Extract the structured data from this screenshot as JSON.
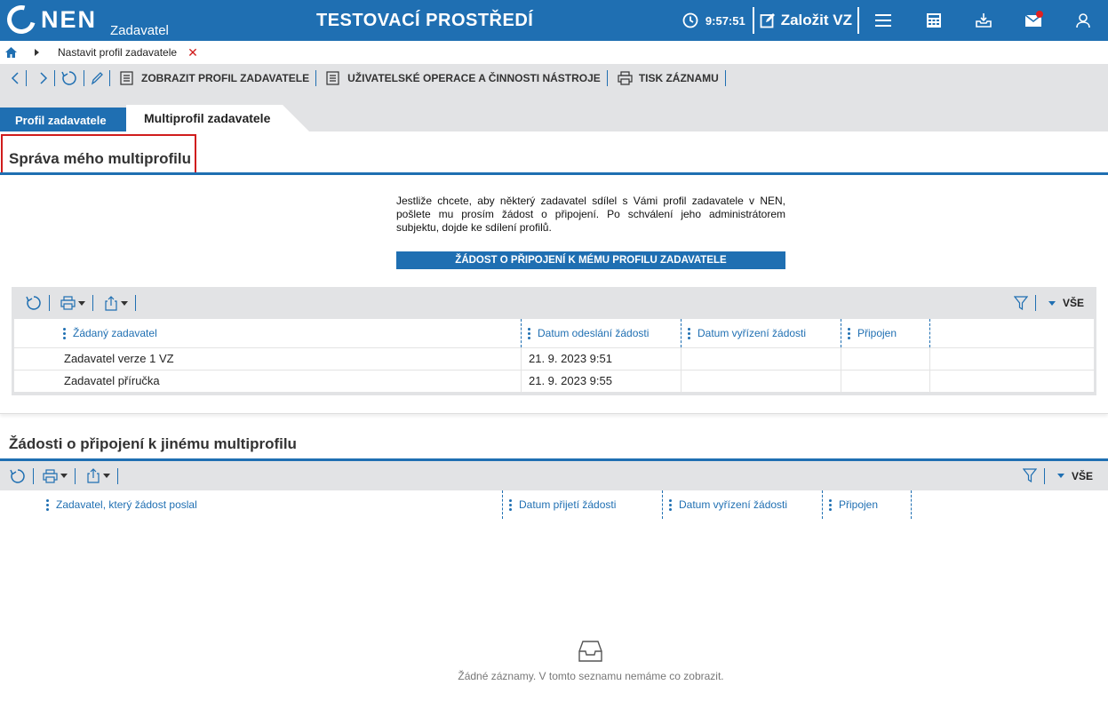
{
  "header": {
    "logo_text": "NEN",
    "logo_sub": "Zadavatel",
    "env_title": "TESTOVACÍ PROSTŘEDÍ",
    "clock": "9:57:51",
    "new_label": "Založit VZ",
    "icons": [
      "clock-icon",
      "edit-icon",
      "menu-icon",
      "calculator-icon",
      "inbox-download-icon",
      "mail-icon",
      "user-icon"
    ],
    "accent": "#1f6fb2",
    "notification_color": "#e02020"
  },
  "breadcrumb": {
    "label": "Nastavit profil zadavatele",
    "close": "✕"
  },
  "toolbar": {
    "show_profile": "ZOBRAZIT PROFIL ZADAVATELE",
    "user_ops": "UŽIVATELSKÉ OPERACE A ČINNOSTI NÁSTROJE",
    "print_record": "TISK ZÁZNAMU"
  },
  "tabs": {
    "profil": "Profil zadavatele",
    "multi": "Multiprofil zadavatele"
  },
  "section1": {
    "title": "Správa mého multiprofilu",
    "info": "Jestliže chcete, aby některý zadavatel sdílel s Vámi profil zadavatele v NEN, pošlete mu prosím žádost o připojení. Po schválení jeho administrátorem subjektu, dojde ke sdílení profilů.",
    "request_button": "ŽÁDOST O PŘIPOJENÍ K MÉMU PROFILU ZADAVATELE",
    "filter_label": "VŠE",
    "columns": [
      "Žádaný zadavatel",
      "Datum odeslání žádosti",
      "Datum vyřízení žádosti",
      "Připojen"
    ],
    "rows": [
      [
        "Zadavatel verze 1 VZ",
        "21. 9. 2023 9:51",
        "",
        ""
      ],
      [
        "Zadavatel příručka",
        "21. 9. 2023 9:55",
        "",
        ""
      ]
    ]
  },
  "section2": {
    "title": "Žádosti o připojení k jinému multiprofilu",
    "filter_label": "VŠE",
    "columns": [
      "Zadavatel, který žádost poslal",
      "Datum přijetí žádosti",
      "Datum vyřízení žádosti",
      "Připojen"
    ],
    "empty": "Žádné záznamy. V tomto seznamu nemáme co zobrazit."
  }
}
